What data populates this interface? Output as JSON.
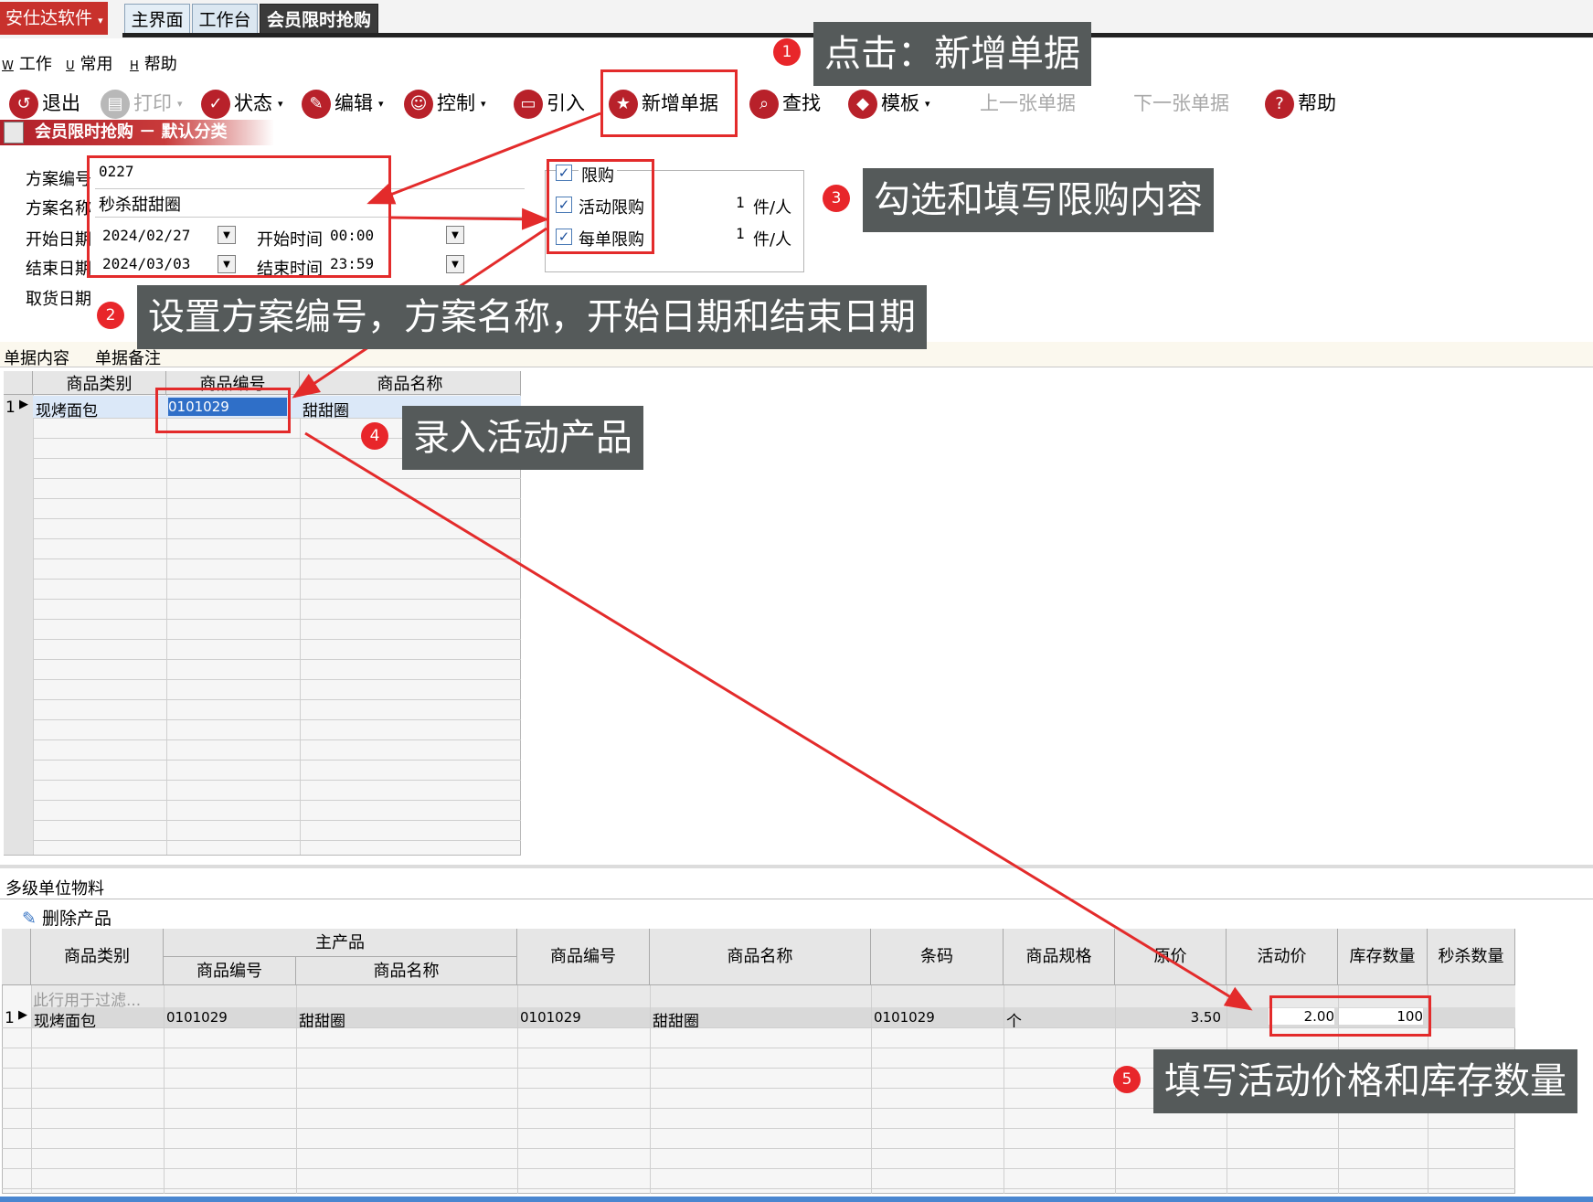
{
  "topbar": {
    "brand": "安仕达软件",
    "tabs": [
      "主界面",
      "工作台",
      "会员限时抢购"
    ]
  },
  "menu": [
    {
      "key": "W",
      "label": "工作"
    },
    {
      "key": "U",
      "label": "常用"
    },
    {
      "key": "H",
      "label": "帮助"
    }
  ],
  "toolbar": {
    "exit": "退出",
    "print": "打印",
    "status": "状态",
    "edit": "编辑",
    "control": "控制",
    "import": "引入",
    "new_doc": "新增单据",
    "find": "查找",
    "template": "模板",
    "prev": "上一张单据",
    "next": "下一张单据",
    "help": "帮助"
  },
  "title": "会员限时抢购 － 默认分类",
  "form": {
    "plan_no_label": "方案编号",
    "plan_no": "0227",
    "plan_name_label": "方案名称",
    "plan_name": "秒杀甜甜圈",
    "start_date_label": "开始日期",
    "start_date": "2024/02/27",
    "start_time_label": "开始时间",
    "start_time": "00:00",
    "end_date_label": "结束日期",
    "end_date": "2024/03/03",
    "end_time_label": "结束时间",
    "end_time": "23:59",
    "pickup_label": "取货日期"
  },
  "limits": {
    "limit_label": "限购",
    "activity_label": "活动限购",
    "activity_value": "1",
    "activity_unit": "件/人",
    "order_label": "每单限购",
    "order_value": "1",
    "order_unit": "件/人"
  },
  "detail_tabs": [
    "单据内容",
    "单据备注"
  ],
  "grid1": {
    "columns": [
      "商品类别",
      "商品编号",
      "商品名称"
    ],
    "rows": [
      {
        "num": "1",
        "category": "现烤面包",
        "code": "0101029",
        "name": "甜甜圈"
      }
    ]
  },
  "lower_tab": "多级单位物料",
  "delete_btn": "删除产品",
  "grid2": {
    "col_category": "商品类别",
    "main_product": "主产品",
    "main_code": "商品编号",
    "main_name": "商品名称",
    "col_code": "商品编号",
    "col_name": "商品名称",
    "col_barcode": "条码",
    "col_spec": "商品规格",
    "col_price": "原价",
    "col_act_price": "活动价",
    "col_stock": "库存数量",
    "col_flash": "秒杀数量",
    "filter_hint": "此行用于过滤...",
    "row": {
      "num": "1",
      "category": "现烤面包",
      "main_code": "0101029",
      "main_name": "甜甜圈",
      "code": "0101029",
      "name": "甜甜圈",
      "barcode": "0101029",
      "spec": "个",
      "price": "3.50",
      "act_price": "2.00",
      "stock": "100"
    }
  },
  "annotations": [
    {
      "num": "1",
      "text": "点击：新增单据"
    },
    {
      "num": "2",
      "text": "设置方案编号，方案名称，开始日期和结束日期"
    },
    {
      "num": "3",
      "text": "勾选和填写限购内容"
    },
    {
      "num": "4",
      "text": "录入活动产品"
    },
    {
      "num": "5",
      "text": "填写活动价格和库存数量"
    }
  ],
  "colors": {
    "brand_red": "#c8312c",
    "annotation_red": "#e32b2b",
    "callout_bg": "#555a5a"
  }
}
